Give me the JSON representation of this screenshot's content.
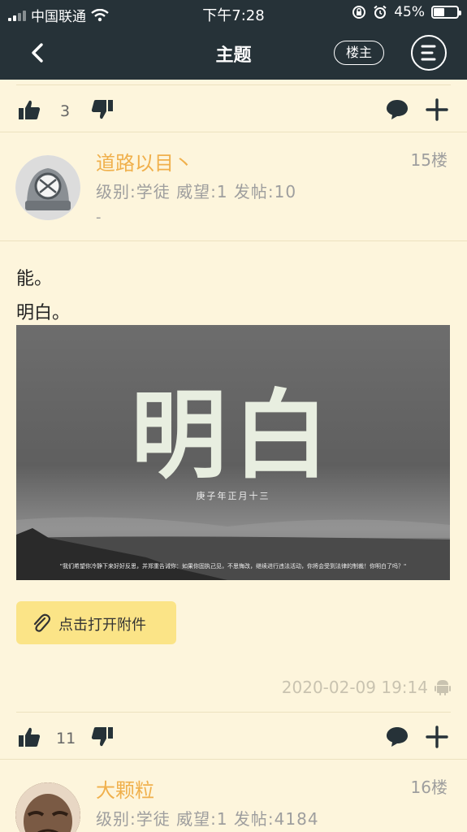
{
  "status_bar": {
    "carrier": "中国联通",
    "time": "下午7:28",
    "battery": "45%",
    "battery_level": 0.45
  },
  "nav": {
    "title": "主题",
    "owner_button": "楼主"
  },
  "prev_post_actions": {
    "like_count": "3"
  },
  "post": {
    "author": "道路以目丶",
    "floor": "15楼",
    "meta": "级别:学徒  威望:1  发帖:10",
    "signature": "-",
    "lines": [
      "能。",
      "明白。"
    ],
    "image": {
      "headline": "明白",
      "date_text": "庚子年正月十三",
      "quote": "\"我们希望你冷静下来好好反思，并郑重告诫你：如果你固执己见，不思悔改，继续进行违法活动，你将会受到法律的制裁！你明白了吗？\""
    },
    "attachment_label": "点击打开附件",
    "timestamp": "2020-02-09 19:14",
    "like_count": "11"
  },
  "next_post": {
    "author": "大颗粒",
    "floor": "16楼",
    "meta": "级别:学徒  威望:1  发帖:4184"
  }
}
